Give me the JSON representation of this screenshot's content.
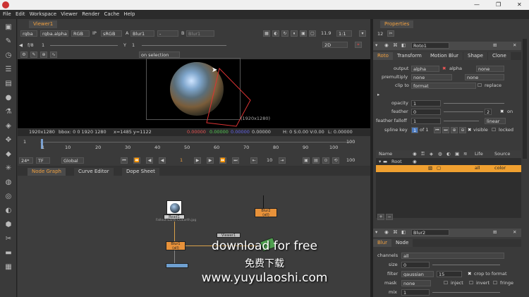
{
  "window": {
    "minimize": "—",
    "maximize": "❐",
    "close": "✕"
  },
  "menu": [
    "File",
    "Edit",
    "Workspace",
    "Viewer",
    "Render",
    "Cache",
    "Help"
  ],
  "viewer": {
    "tab": "Viewer1",
    "channels": "rgba",
    "channel_alpha": "rgba.alpha",
    "display_mode": "RGB",
    "ip": "IP",
    "colorspace": "sRGB",
    "a_label": "A",
    "input_a": "Blur1",
    "b_label": "B",
    "input_b": "Blur1",
    "zoom": "1:1",
    "gain_label": "f/8",
    "gain_value": "1",
    "gamma_label": "Y",
    "gamma_value": "1",
    "view_mode": "2D",
    "roi": "on selection",
    "frame_label": "(1920x1280)",
    "info_res": "1920x1280",
    "info_bbox": "bbox: 0 0 1920 1280",
    "info_xy": "x=1485 y=1122",
    "info_r": "0.00000",
    "info_g": "0.00000",
    "info_b": "0.00000",
    "info_a": "0.00000",
    "info_h": "H: 0 S:0.00 V:0.00",
    "info_l": "L: 0.00000",
    "fps_value": "11.9",
    "frame_in": "1",
    "frame_out": "100",
    "fps": "24*",
    "tf": "TF",
    "global": "Global",
    "current_frame": "1",
    "step": "10",
    "end_frame": "100",
    "ticks": [
      "1",
      "10",
      "20",
      "30",
      "40",
      "50",
      "60",
      "70",
      "80",
      "90",
      "100"
    ]
  },
  "graph": {
    "tabs": [
      "Node Graph",
      "Curve Editor",
      "Dope Sheet"
    ],
    "nodes": {
      "read1": "Read1",
      "read1_file": "Fallout-Earth-CGEarth.jpg",
      "blur2": "Blur2",
      "blur2_sub": "(all)",
      "blur1": "Blur1",
      "blur1_sub": "(all)",
      "viewer1": "Viewer1",
      "roto1": "Roto1"
    }
  },
  "properties": {
    "title": "Properties",
    "num": "12",
    "roto": {
      "name": "Roto1",
      "tabs": [
        "Roto",
        "Transform",
        "Motion Blur",
        "Shape",
        "Clone"
      ],
      "output_label": "output",
      "output": "alpha",
      "alpha_chk": "alpha",
      "output2": "none",
      "premult_label": "premultiply",
      "premult": "none",
      "premult2": "none",
      "clipto_label": "clip to",
      "clipto": "format",
      "replace": "replace",
      "opacity_label": "opacity",
      "opacity": "1",
      "feather_label": "feather",
      "feather": "0",
      "feather_num": "2",
      "feather_on": "on",
      "falloff_label": "feather falloff",
      "falloff": "1",
      "falloff_type": "linear",
      "splinekey_label": "spline key",
      "splinekey": "1",
      "splinekey_of": "of 1",
      "visible": "visible",
      "locked": "locked",
      "layer_cols": [
        "Name",
        "Life",
        "Source"
      ],
      "layers": [
        {
          "name": "Root"
        },
        {
          "name": "",
          "life": "all",
          "source": "color"
        }
      ]
    },
    "blur": {
      "name": "Blur2",
      "tabs": [
        "Blur",
        "Node"
      ],
      "channels_label": "channels",
      "channels": "all",
      "size_label": "size",
      "size": "0",
      "filter_label": "filter",
      "filter": "gaussian",
      "filter_q": "15",
      "crop": "crop to format",
      "mask_label": "mask",
      "mask": "none",
      "inject": "inject",
      "invert": "invert",
      "fringe": "fringe",
      "mix_label": "mix",
      "mix": "1"
    }
  },
  "overlay": {
    "line1": "download for free",
    "line2": "免费下载",
    "line3": "www.yuyulaoshi.com"
  }
}
